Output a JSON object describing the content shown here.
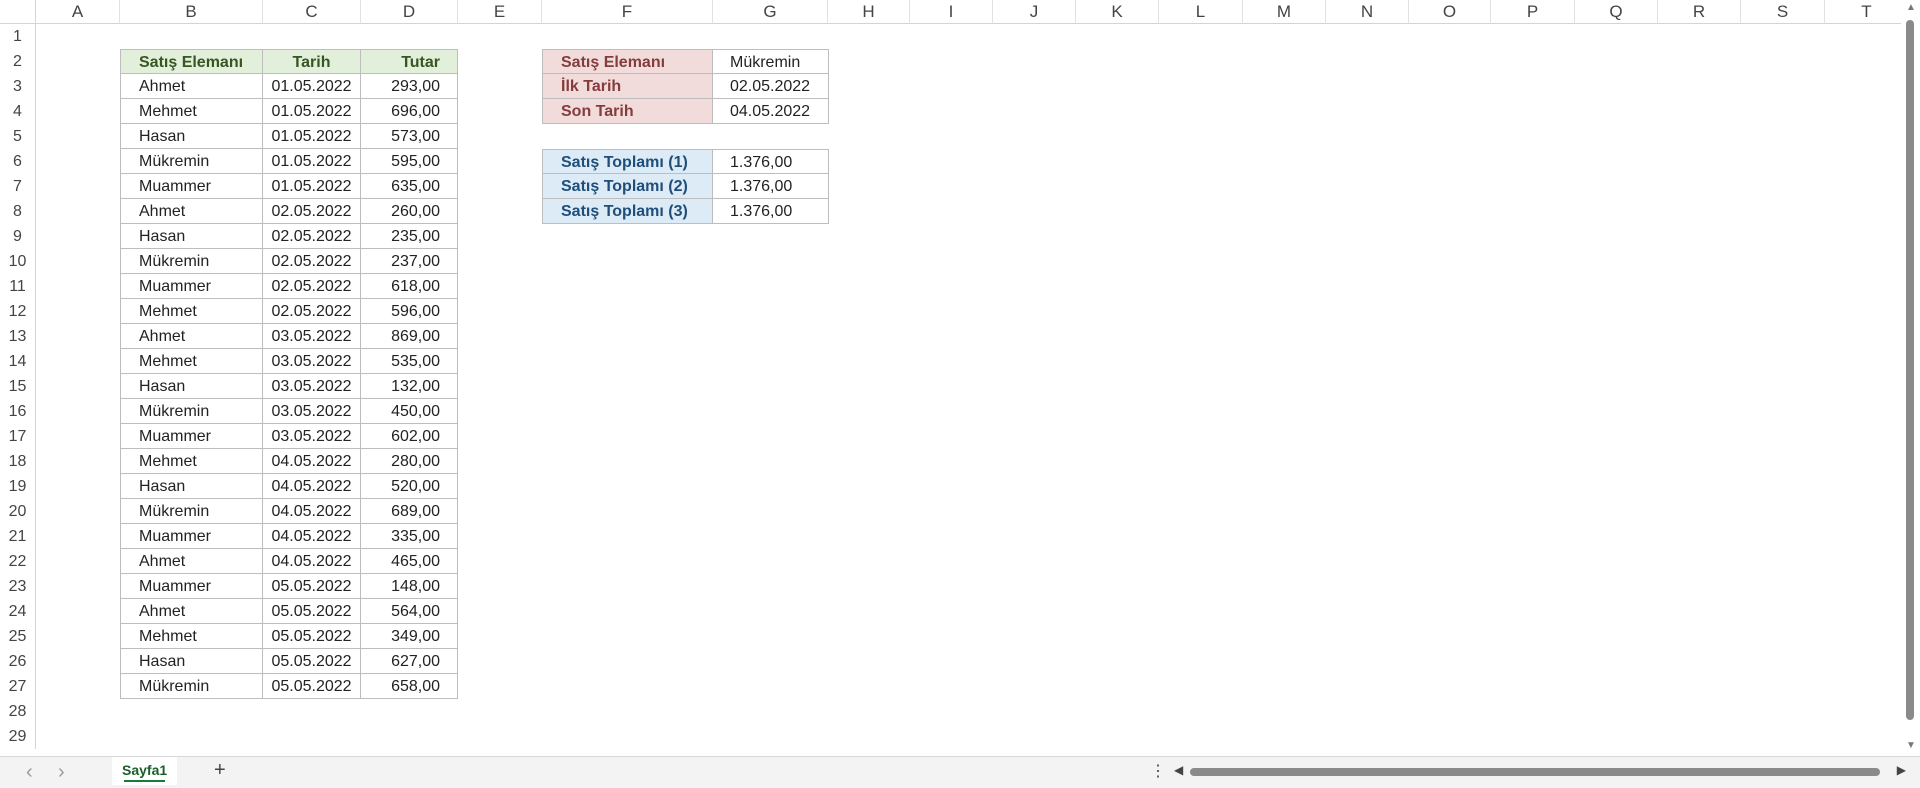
{
  "columns": [
    "A",
    "B",
    "C",
    "D",
    "E",
    "F",
    "G",
    "H",
    "I",
    "J",
    "K",
    "L",
    "M",
    "N",
    "O",
    "P",
    "Q",
    "R",
    "S",
    "T"
  ],
  "rows": [
    "1",
    "2",
    "3",
    "4",
    "5",
    "6",
    "7",
    "8",
    "9",
    "10",
    "11",
    "12",
    "13",
    "14",
    "15",
    "16",
    "17",
    "18",
    "19",
    "20",
    "21",
    "22",
    "23",
    "24",
    "25",
    "26",
    "27",
    "28",
    "29"
  ],
  "sales_table": {
    "headers": [
      "Satış Elemanı",
      "Tarih",
      "Tutar"
    ],
    "rows": [
      [
        "Ahmet",
        "01.05.2022",
        "293,00"
      ],
      [
        "Mehmet",
        "01.05.2022",
        "696,00"
      ],
      [
        "Hasan",
        "01.05.2022",
        "573,00"
      ],
      [
        "Mükremin",
        "01.05.2022",
        "595,00"
      ],
      [
        "Muammer",
        "01.05.2022",
        "635,00"
      ],
      [
        "Ahmet",
        "02.05.2022",
        "260,00"
      ],
      [
        "Hasan",
        "02.05.2022",
        "235,00"
      ],
      [
        "Mükremin",
        "02.05.2022",
        "237,00"
      ],
      [
        "Muammer",
        "02.05.2022",
        "618,00"
      ],
      [
        "Mehmet",
        "02.05.2022",
        "596,00"
      ],
      [
        "Ahmet",
        "03.05.2022",
        "869,00"
      ],
      [
        "Mehmet",
        "03.05.2022",
        "535,00"
      ],
      [
        "Hasan",
        "03.05.2022",
        "132,00"
      ],
      [
        "Mükremin",
        "03.05.2022",
        "450,00"
      ],
      [
        "Muammer",
        "03.05.2022",
        "602,00"
      ],
      [
        "Mehmet",
        "04.05.2022",
        "280,00"
      ],
      [
        "Hasan",
        "04.05.2022",
        "520,00"
      ],
      [
        "Mükremin",
        "04.05.2022",
        "689,00"
      ],
      [
        "Muammer",
        "04.05.2022",
        "335,00"
      ],
      [
        "Ahmet",
        "04.05.2022",
        "465,00"
      ],
      [
        "Muammer",
        "05.05.2022",
        "148,00"
      ],
      [
        "Ahmet",
        "05.05.2022",
        "564,00"
      ],
      [
        "Mehmet",
        "05.05.2022",
        "349,00"
      ],
      [
        "Hasan",
        "05.05.2022",
        "627,00"
      ],
      [
        "Mükremin",
        "05.05.2022",
        "658,00"
      ]
    ]
  },
  "criteria": [
    {
      "label": "Satış Elemanı",
      "value": "Mükremin"
    },
    {
      "label": "İlk Tarih",
      "value": "02.05.2022"
    },
    {
      "label": "Son Tarih",
      "value": "04.05.2022"
    }
  ],
  "totals": [
    {
      "label": "Satış Toplamı (1)",
      "value": "1.376,00"
    },
    {
      "label": "Satış Toplamı (2)",
      "value": "1.376,00"
    },
    {
      "label": "Satış Toplamı (3)",
      "value": "1.376,00"
    }
  ],
  "bottom": {
    "sheet_tab": "Sayfa1",
    "add_sheet": "+",
    "more": "⋮",
    "prev": "‹",
    "next": "›"
  },
  "colors": {
    "header_green_bg": "#e2efda",
    "header_red_bg": "#f2dcdb",
    "header_blue_bg": "#ddebf7"
  }
}
